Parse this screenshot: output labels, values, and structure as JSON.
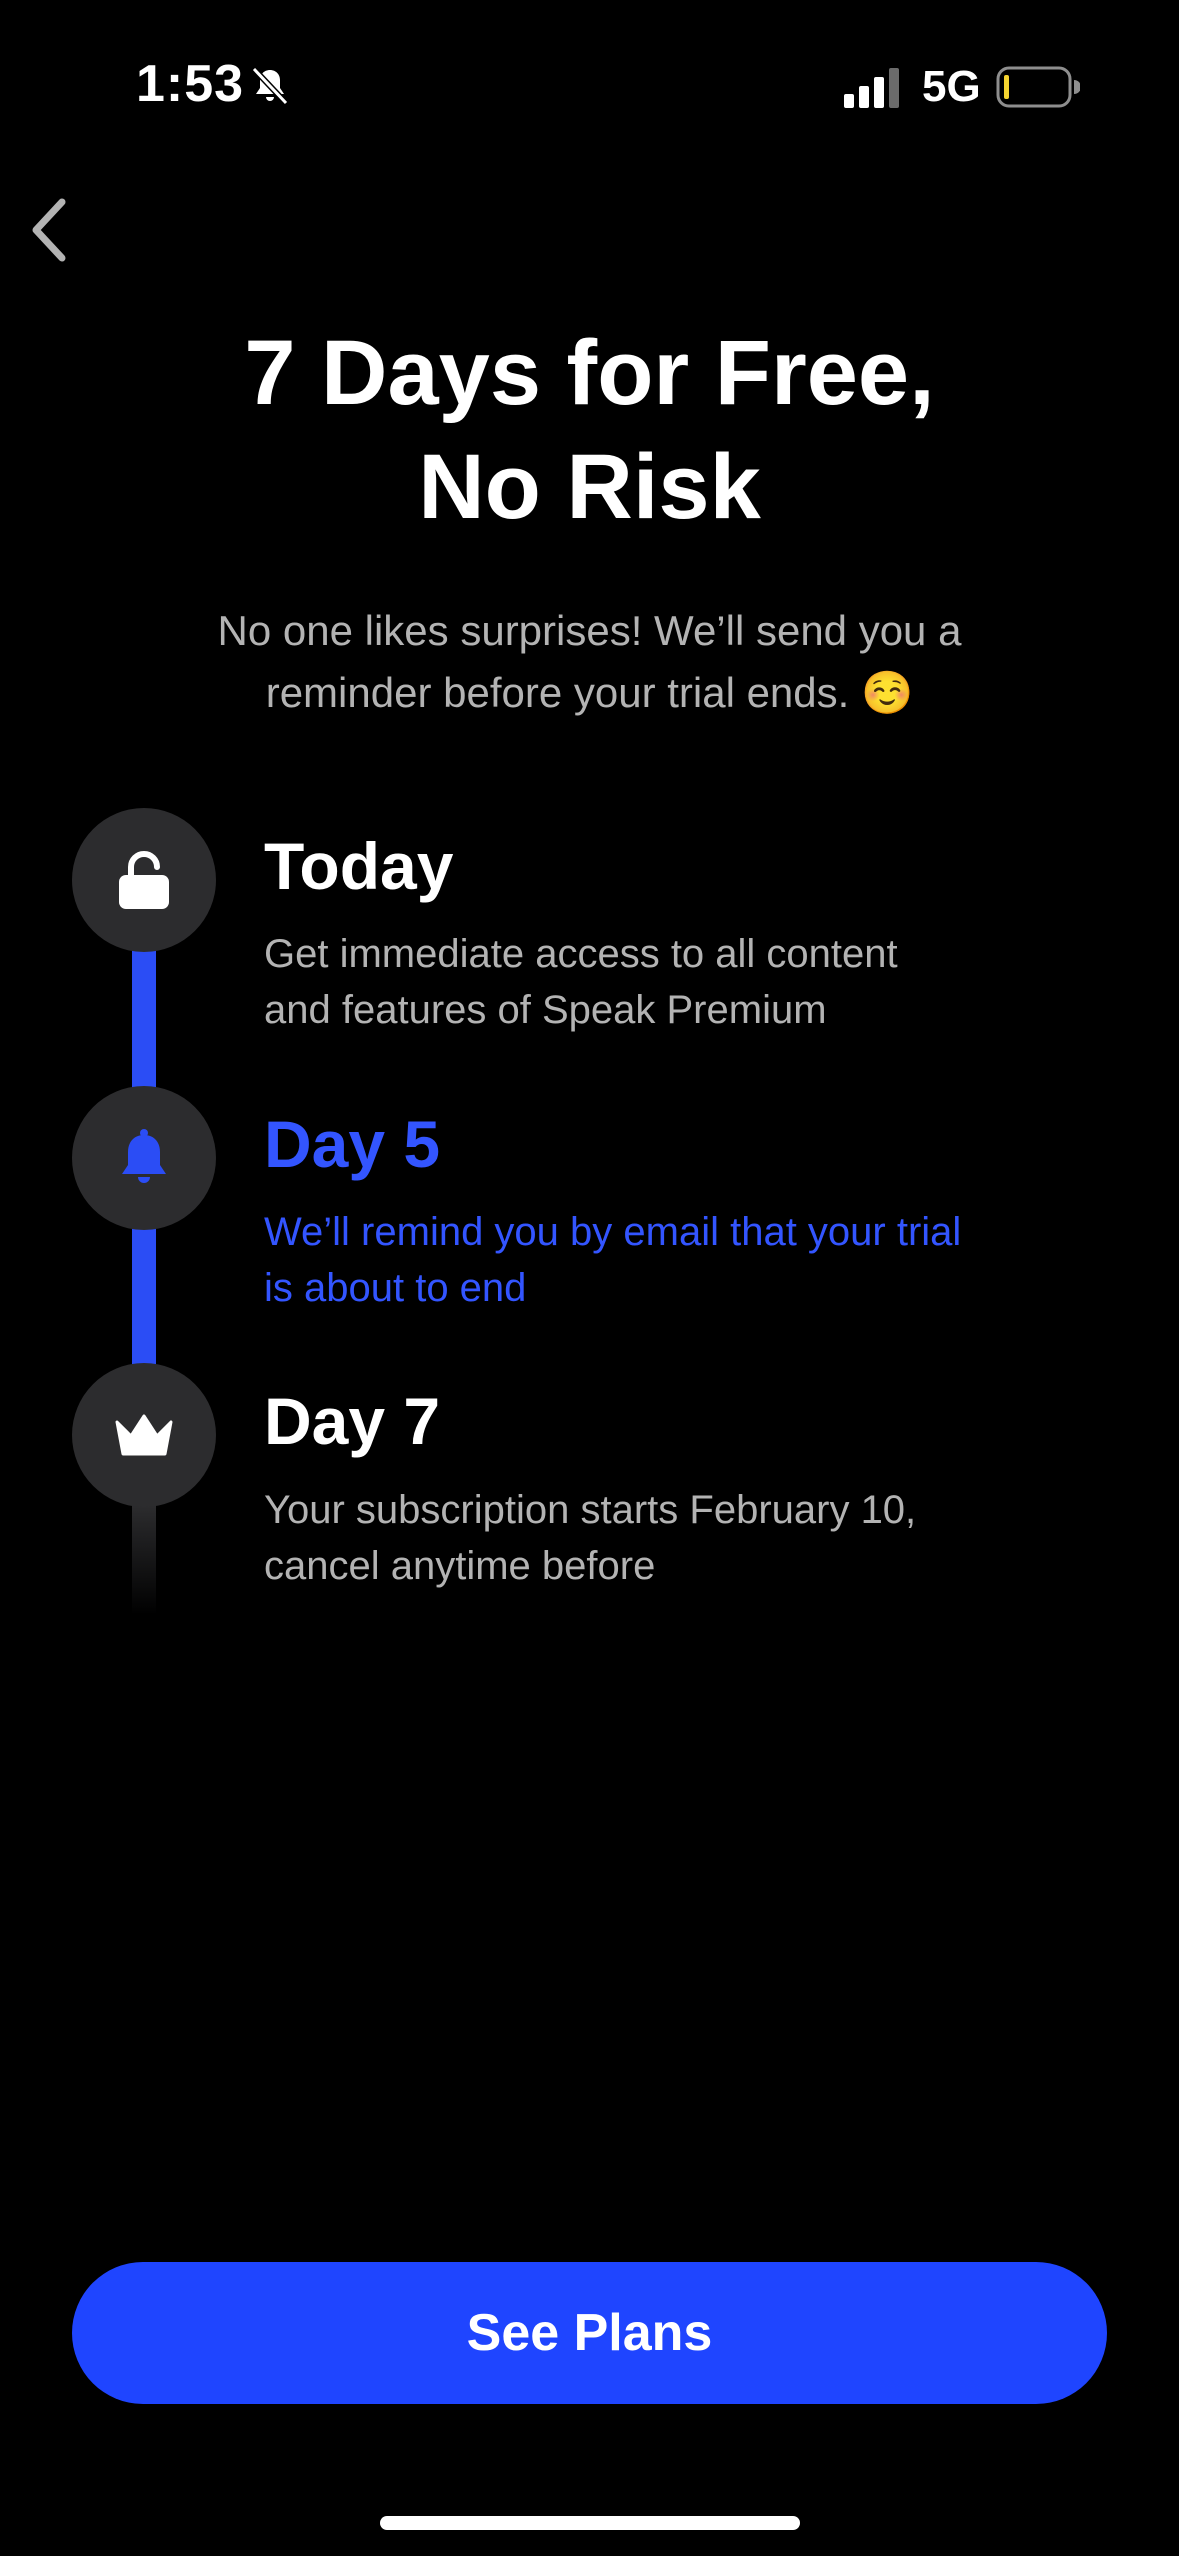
{
  "status_bar": {
    "time": "1:53",
    "network": "5G",
    "icons": [
      "bell-slash-icon",
      "cellular-signal-icon",
      "battery-icon"
    ],
    "battery_color": "#f5d430"
  },
  "nav": {
    "back_icon": "chevron-left-icon"
  },
  "header": {
    "title_line_1": "7 Days for Free,",
    "title_line_2": "No Risk",
    "subtitle_line_1": "No one likes surprises! We’ll send you a",
    "subtitle_line_2": "reminder before your trial ends. ☺️"
  },
  "timeline": {
    "accent_color": "#2b4df5",
    "steps": [
      {
        "icon": "unlock-icon",
        "title": "Today",
        "desc_line_1": "Get immediate access to all content",
        "desc_line_2": "and features of Speak Premium",
        "highlighted": false
      },
      {
        "icon": "bell-icon",
        "title": "Day 5",
        "desc_line_1": "We’ll remind you by email that your trial",
        "desc_line_2": "is about to end",
        "highlighted": true
      },
      {
        "icon": "crown-icon",
        "title": "Day 7",
        "desc_line_1": "Your subscription starts February 10,",
        "desc_line_2": "cancel anytime before",
        "highlighted": false
      }
    ]
  },
  "cta": {
    "label": "See Plans",
    "color": "#1f45ff"
  }
}
